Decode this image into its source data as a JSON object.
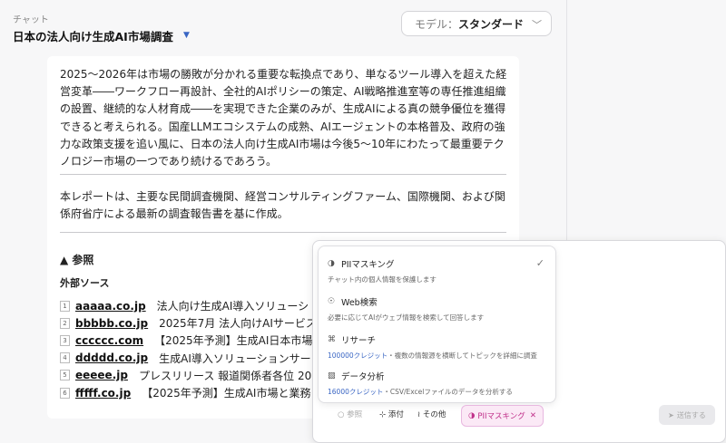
{
  "header": {
    "subtitle": "チャット",
    "title": "日本の法人向け生成AI市場調査",
    "caret": "▼"
  },
  "model": {
    "label": "モデル：",
    "value": "スタンダード",
    "chevron": "﹀"
  },
  "document": {
    "paragraph1": "2025～2026年は市場の勝敗が分かれる重要な転換点であり、単なるツール導入を超えた経営変革――ワークフロー再設計、全社的AIポリシーの策定、AI戦略推進室等の専任推進組織の設置、継続的な人材育成――を実現できた企業のみが、生成AIによる真の競争優位を獲得できると考えられる。国産LLMエコシステムの成熟、AIエージェントの本格普及、政府の強力な政策支援を追い風に、日本の法人向け生成AI市場は今後5～10年にわたって最重要テクノロジー市場の一つであり続けるであろう。",
    "paragraph2": "本レポートは、主要な民間調査機関、経営コンサルティングファーム、国際機関、および関係府省庁による最新の調査報告書を基に作成。",
    "refs_heading": "▲ 参照",
    "refs_subheading": "外部ソース",
    "references": [
      {
        "num": "1",
        "link": "aaaaa.co.jp",
        "desc": "法人向け生成AI導入ソリューシ"
      },
      {
        "num": "2",
        "link": "bbbbb.co.jp",
        "desc": "2025年7月 法人向けAIサービス"
      },
      {
        "num": "3",
        "link": "cccccc.com",
        "desc": "【2025年予測】生成AI日本市場"
      },
      {
        "num": "4",
        "link": "ddddd.co.jp",
        "desc": "生成AI導入ソリューションサー"
      },
      {
        "num": "5",
        "link": "eeeee.jp",
        "desc": "プレスリリース 報道関係者各位 20"
      },
      {
        "num": "6",
        "link": "fffff.co.jp",
        "desc": "【2025年予測】生成AI市場と業務"
      }
    ]
  },
  "menu": {
    "items": [
      {
        "icon": "PII",
        "title": "PIIマスキング",
        "desc": "チャット内の個人情報を保護します",
        "credit": "",
        "checked": "✓"
      },
      {
        "icon": "web",
        "title": "Web検索",
        "desc": "必要に応じてAIがウェブ情報を検索して回答します",
        "credit": "",
        "checked": ""
      },
      {
        "icon": "research",
        "title": "リサーチ",
        "credit": "100000クレジット",
        "desc": "・複数の情報源を横断してトピックを詳細に調査",
        "checked": ""
      },
      {
        "icon": "chart",
        "title": "データ分析",
        "credit": "16000クレジット",
        "desc": "・CSV/Excelファイルのデータを分析する",
        "checked": ""
      }
    ]
  },
  "toolbar": {
    "reference": "参照",
    "attach": "添付",
    "other": "その他",
    "pii_chip": "PIIマスキング",
    "pii_close": "✕",
    "send": "送信する"
  },
  "colors": {
    "accent": "#3a66c4",
    "chip_bg": "#fbe9f6",
    "chip_text": "#c0308a"
  }
}
